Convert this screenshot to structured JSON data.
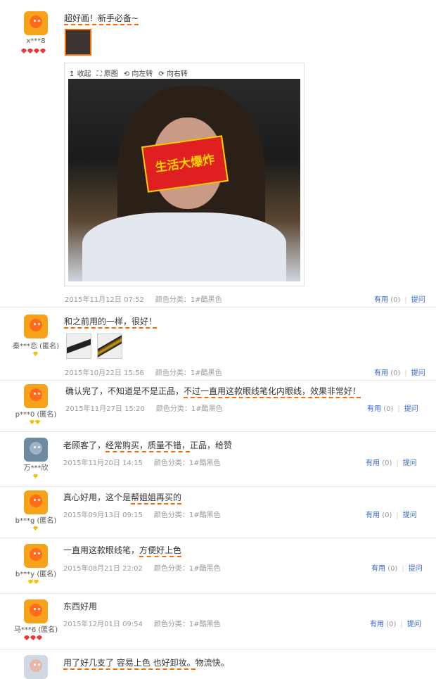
{
  "image_viewer": {
    "toolbar": [
      "收起",
      "原图",
      "向左转",
      "向右转"
    ],
    "watermark": "生活大爆炸"
  },
  "reviews": [
    {
      "user": "x***8",
      "badge": "hearts",
      "badge_count": 4,
      "text_prefix": "",
      "text_highlight": "超好画！新手必备~",
      "text_suffix": "",
      "date": "2015年11月12日 07:52",
      "color": "颜色分类：1#酷黑色",
      "useful": "有用",
      "count": "(0)",
      "reply": "提问"
    },
    {
      "user": "秦***恋 (匿名)",
      "badge": "gems",
      "badge_count": 1,
      "text_prefix": "",
      "text_highlight": "和之前用的一样，很好！",
      "text_suffix": "",
      "date": "2015年10月22日 15:56",
      "color": "颜色分类：1#酷黑色",
      "useful": "有用",
      "count": "(0)",
      "reply": "提问"
    },
    {
      "user": "p***0 (匿名)",
      "badge": "gems",
      "badge_count": 2,
      "text_prefix": "确认完了，不知道是不是正品，",
      "text_highlight": "不过一直用这款眼线笔化内眼线，效果非常好！",
      "text_suffix": "",
      "date": "2015年11月27日 15:20",
      "color": "颜色分类：1#酷黑色",
      "useful": "有用",
      "count": "(0)",
      "reply": "提问"
    },
    {
      "user": "万***欣",
      "badge": "gems",
      "badge_count": 1,
      "text_prefix": "老顾客了，",
      "text_highlight": "经常购买，质量不错，",
      "text_suffix": "正品，给赞",
      "date": "2015年11月20日 14:15",
      "color": "颜色分类：1#酷黑色",
      "useful": "有用",
      "count": "(0)",
      "reply": "提问"
    },
    {
      "user": "b***g (匿名)",
      "badge": "gems",
      "badge_count": 1,
      "text_prefix": "真心好用，这个是",
      "text_highlight": "帮姐姐再买的",
      "text_suffix": "",
      "date": "2015年09月13日 09:15",
      "color": "颜色分类：1#酷黑色",
      "useful": "有用",
      "count": "(0)",
      "reply": "提问"
    },
    {
      "user": "b***y (匿名)",
      "badge": "gems",
      "badge_count": 2,
      "text_prefix": "一直用这款眼线笔，",
      "text_highlight": "方便好上色",
      "text_suffix": "",
      "date": "2015年08月21日 22:02",
      "color": "颜色分类：1#酷黑色",
      "useful": "有用",
      "count": "(0)",
      "reply": "提问"
    },
    {
      "user": "马***6 (匿名)",
      "badge": "hearts",
      "badge_count": 3,
      "text_prefix": "东西好用",
      "text_highlight": "",
      "text_suffix": "",
      "date": "2015年12月01日 09:54",
      "color": "颜色分类：1#酷黑色",
      "useful": "有用",
      "count": "(0)",
      "reply": "提问"
    },
    {
      "user": "",
      "badge": "none",
      "badge_count": 0,
      "text_prefix": "",
      "text_highlight": "用了好几支了 容易上色 也好卸妆。",
      "text_suffix": "物流快。",
      "date": "",
      "color": "",
      "useful": "",
      "count": "",
      "reply": ""
    }
  ]
}
